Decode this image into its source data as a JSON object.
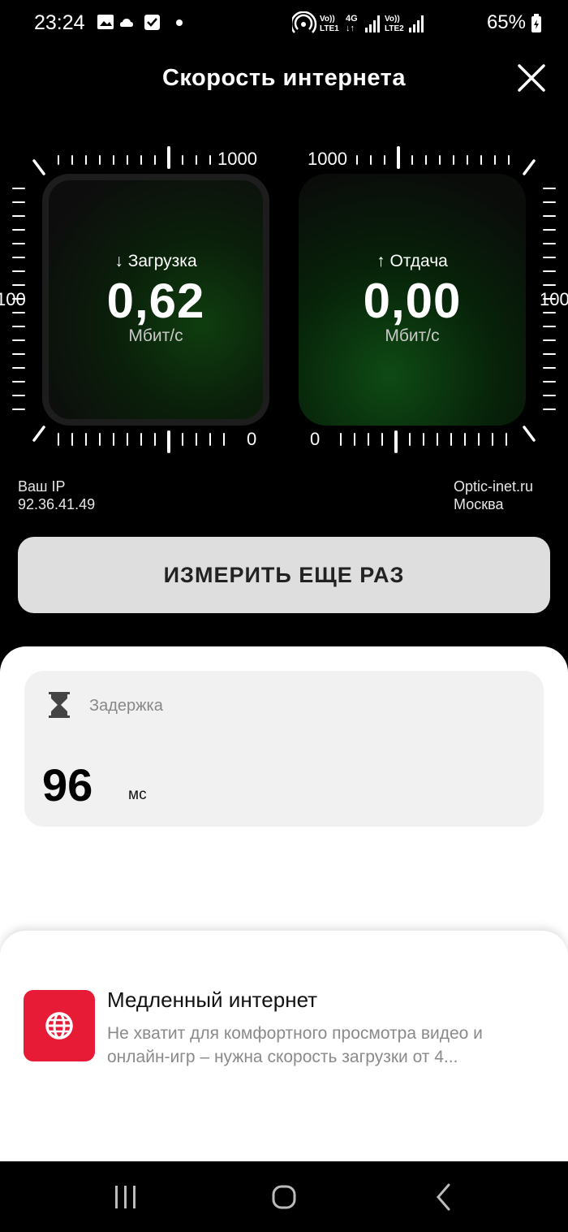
{
  "status_bar": {
    "time": "23:24",
    "battery": "65%",
    "sim1": "LTE1",
    "sim2": "LTE2",
    "network": "4G"
  },
  "header": {
    "title": "Скорость интернета",
    "close_icon": "close-icon"
  },
  "download": {
    "label": "↓ Загрузка",
    "value": "0,62",
    "unit": "Мбит/с",
    "scale_top": "1000",
    "scale_mid": "100",
    "scale_bottom": "0"
  },
  "upload": {
    "label": "↑ Отдача",
    "value": "0,00",
    "unit": "Мбит/с",
    "scale_top": "1000",
    "scale_mid": "100",
    "scale_bottom": "0"
  },
  "info": {
    "ip_label": "Ваш IP",
    "ip_value": "92.36.41.49",
    "provider": "Optic-inet.ru",
    "city": "Москва"
  },
  "retry_button": "ИЗМЕРИТЬ ЕЩЕ РАЗ",
  "latency": {
    "title": "Задержка",
    "value": "96",
    "unit": "мс"
  },
  "warning": {
    "title": "Медленный интернет",
    "description": "Не хватит для комфортного просмотра видео и онлайн-игр – нужна скорость загрузки от 4...",
    "icon": "globe-icon",
    "color": "#e81b37"
  },
  "colors": {
    "accent_green": "#0e4a14",
    "warning_red": "#e81b37",
    "button_bg": "#dedede"
  }
}
